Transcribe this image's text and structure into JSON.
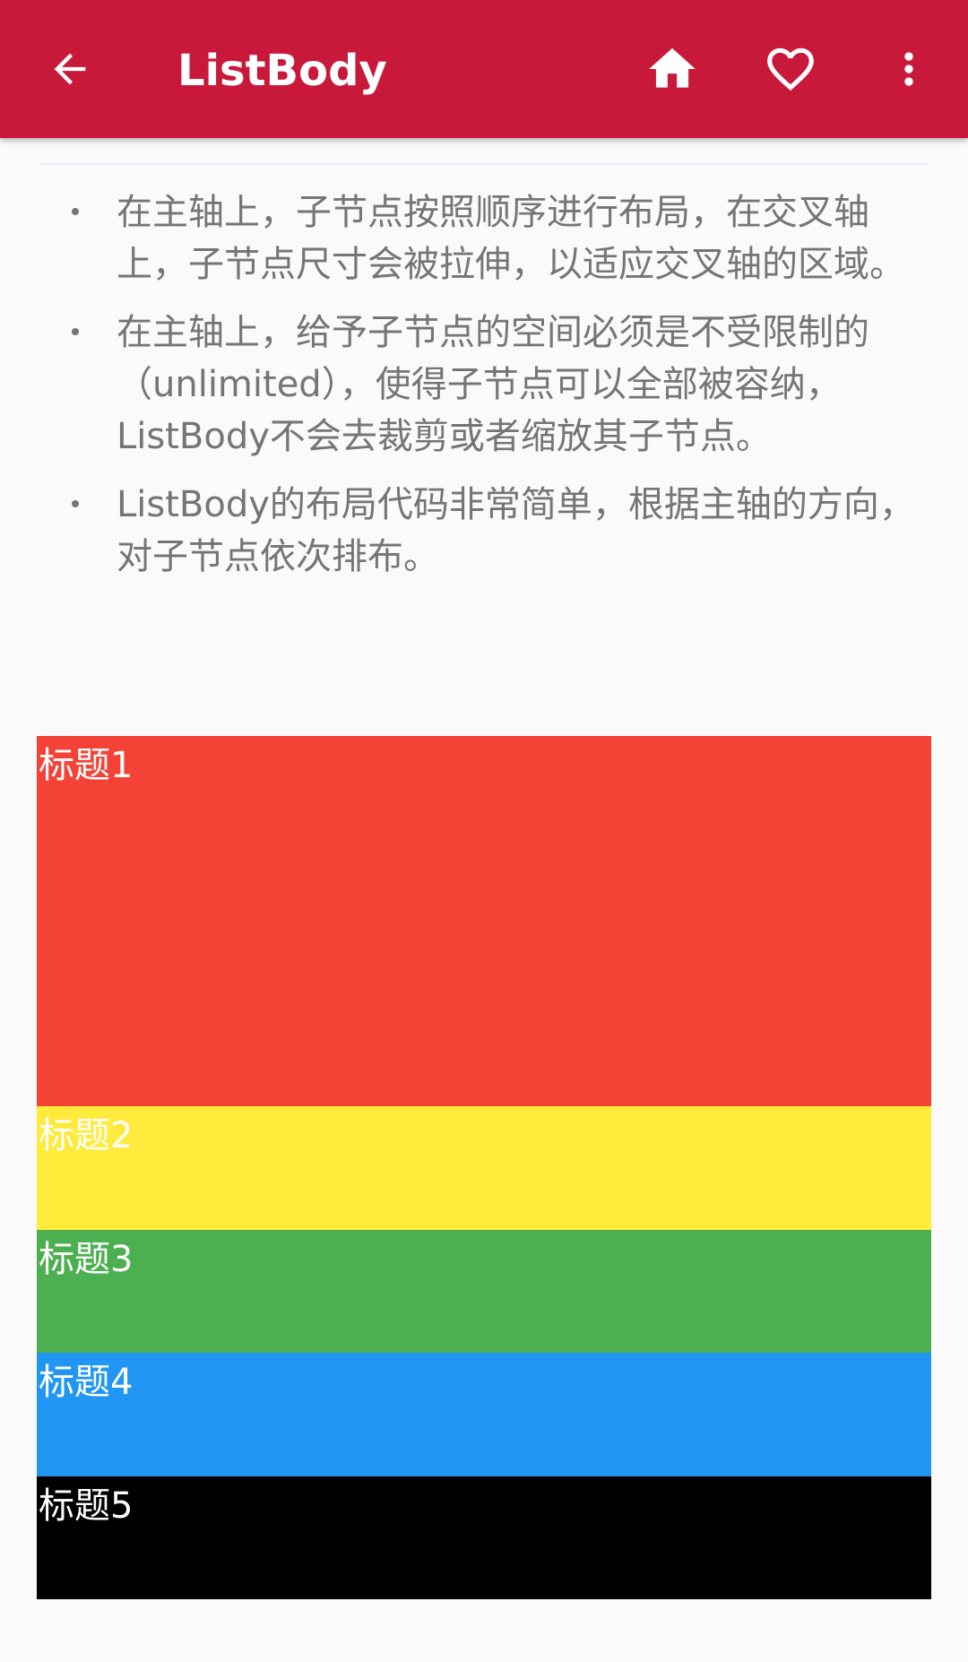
{
  "appbar": {
    "title": "ListBody",
    "back_icon": "arrow-back-icon",
    "home_icon": "home-icon",
    "favorite_icon": "heart-outline-icon",
    "more_icon": "more-vert-icon",
    "background": "#c8193a"
  },
  "bullets": [
    "在主轴上，子节点按照顺序进行布局，在交叉轴上，子节点尺寸会被拉伸，以适应交叉轴的区域。",
    "在主轴上，给予子节点的空间必须是不受限制的（unlimited），使得子节点可以全部被容纳，ListBody不会去裁剪或者缩放其子节点。",
    "ListBody的布局代码非常简单，根据主轴的方向，对子节点依次排布。"
  ],
  "blocks": [
    {
      "label": "标题1",
      "color": "#f44336"
    },
    {
      "label": "标题2",
      "color": "#ffeb3b"
    },
    {
      "label": "标题3",
      "color": "#4caf50"
    },
    {
      "label": "标题4",
      "color": "#2196f3"
    },
    {
      "label": "标题5",
      "color": "#000000"
    }
  ]
}
